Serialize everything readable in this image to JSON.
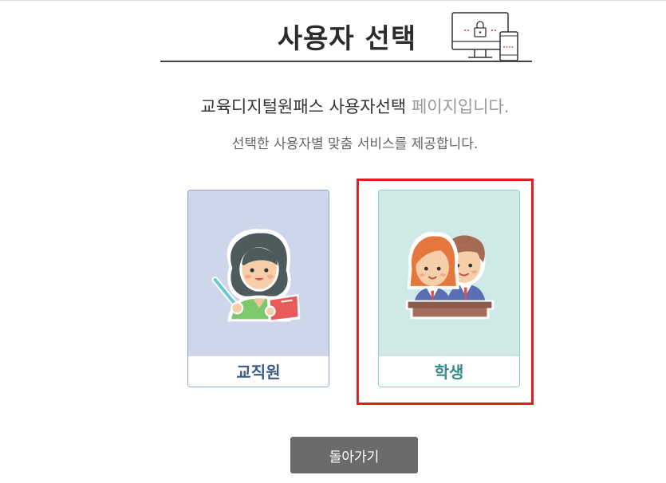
{
  "header": {
    "title": "사용자 선택"
  },
  "intro": {
    "main_text": "교육디지털원패스 사용자선택",
    "muted_text": "페이지입니다.",
    "sub_text": "선택한 사용자별 맞춤 서비스를 제공합니다."
  },
  "cards": [
    {
      "label": "교직원",
      "icon": "teacher-icon",
      "selected": false
    },
    {
      "label": "학생",
      "icon": "students-icon",
      "selected": true
    }
  ],
  "back_button": {
    "label": "돌아가기"
  },
  "colors": {
    "staff_bg": "#cdd6ea",
    "staff_text": "#3c5a8c",
    "student_bg": "#cfeae6",
    "student_text": "#2f8f86",
    "selection_border": "#e02020",
    "button_bg": "#6b6b6b"
  }
}
